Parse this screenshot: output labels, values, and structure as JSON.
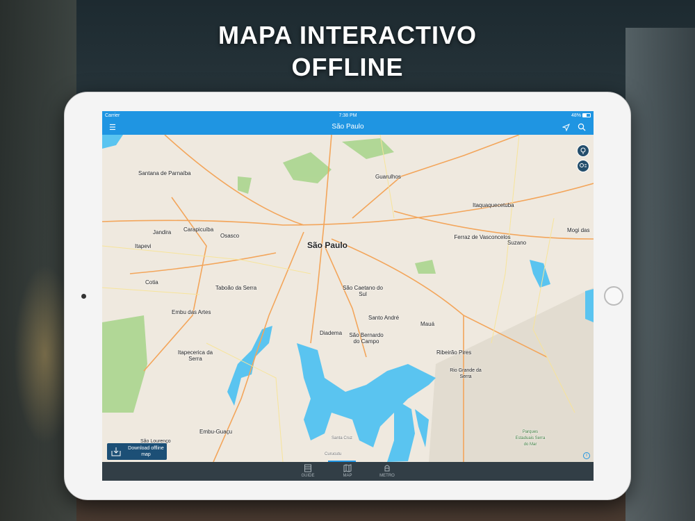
{
  "headline": {
    "line1": "MAPA INTERACTIVO",
    "line2": "OFFLINE"
  },
  "status_bar": {
    "carrier": "Carrier",
    "time": "7:38 PM",
    "battery": "48%"
  },
  "nav": {
    "title": "São Paulo",
    "menu_icon": "hamburger-icon",
    "location_icon": "location-arrow-icon",
    "search_icon": "search-icon"
  },
  "map": {
    "labels": [
      "São Paulo",
      "Santana de Parnaíba",
      "Guarulhos",
      "Itaquaquecetuba",
      "Carapicuíba",
      "Osasco",
      "Jandira",
      "Itapevi",
      "Ferraz de Vasconcelos",
      "Suzano",
      "Mogi das",
      "Cotia",
      "Taboão da Serra",
      "São Caetano do Sul",
      "Embu das Artes",
      "Santo André",
      "Mauá",
      "Diadema",
      "São Bernardo do Campo",
      "Ribeirão Pires",
      "Itapecerica da Serra",
      "Rio Grande da Serra",
      "Embu-Guaçu",
      "São Lourenço",
      "Santa Cruz",
      "Curucutu",
      "Parques Estaduais Serra do Mar"
    ],
    "download_button": "Download offline map"
  },
  "tabs": [
    {
      "label": "GUIDE",
      "icon": "guide-icon"
    },
    {
      "label": "MAP",
      "icon": "map-icon",
      "active": true
    },
    {
      "label": "METRO",
      "icon": "metro-icon"
    }
  ],
  "colors": {
    "accent": "#1f95e2",
    "tabbar": "#323e46",
    "water": "#5ac4f0",
    "park": "#a6d48a"
  }
}
